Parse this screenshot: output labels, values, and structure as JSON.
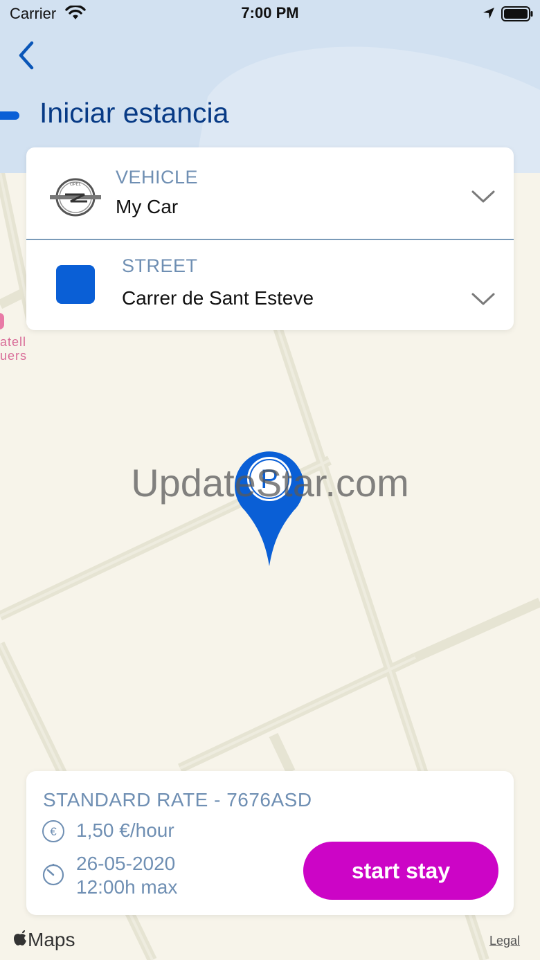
{
  "status_bar": {
    "carrier": "Carrier",
    "time": "7:00 PM",
    "icons": [
      "wifi-icon",
      "location-arrow-icon",
      "battery-icon"
    ]
  },
  "header": {
    "title": "Iniciar estancia",
    "back_icon": "chevron-left-icon"
  },
  "vehicle": {
    "label": "VEHICLE",
    "value": "My Car",
    "icon": "opel-logo-icon"
  },
  "street": {
    "label": "STREET",
    "value": "Carrer de Sant Esteve",
    "icon": "street-zone-icon",
    "zone_color": "#0a5fd6"
  },
  "map": {
    "poi_label_line1": "atell",
    "poi_label_line2": "uers",
    "pin_letter": "P",
    "watermark": "UpdateStar.com",
    "attribution": "Maps",
    "legal_label": "Legal"
  },
  "rate": {
    "title": "STANDARD RATE - 7676ASD",
    "price": "1,50 €/hour",
    "date": "26-05-2020",
    "max": "12:00h max",
    "button_label": "start stay",
    "button_color": "#cc05c6"
  },
  "colors": {
    "accent": "#0a5fd6",
    "title": "#073a85",
    "label": "#6f8fb3",
    "map_bg": "#f7f4ea",
    "header_bg": "#d2e1f1"
  }
}
